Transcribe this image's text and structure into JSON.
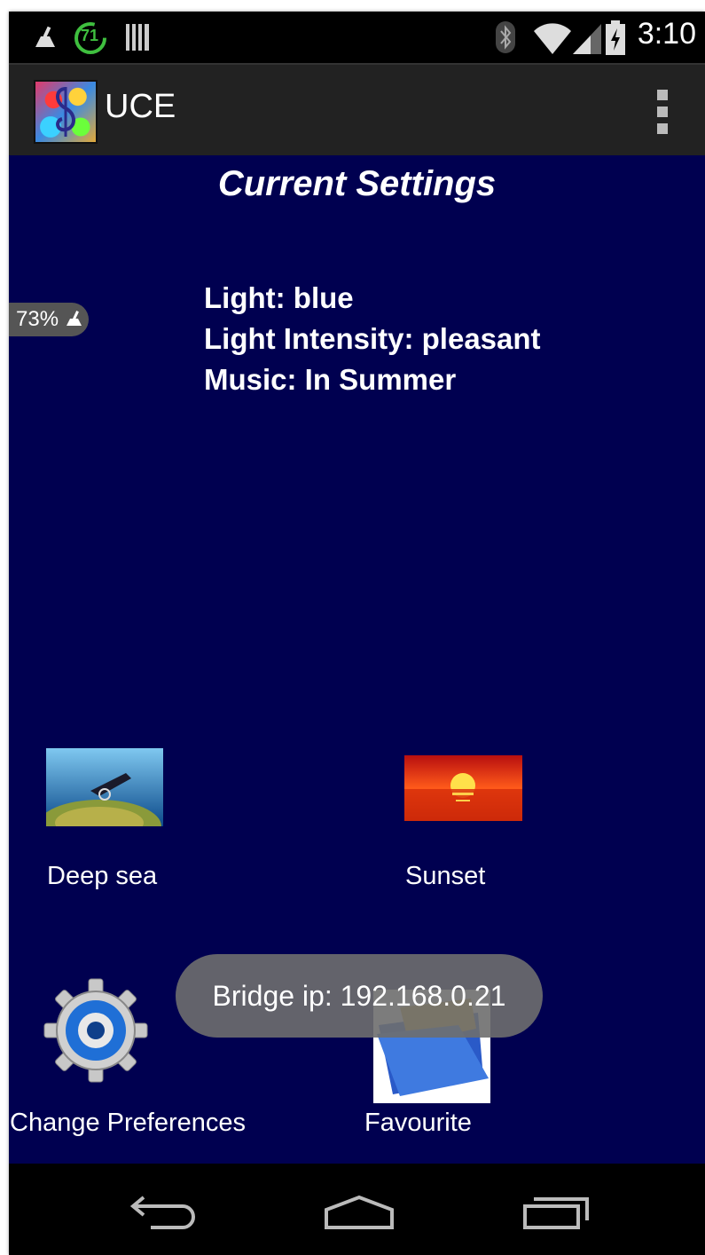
{
  "status_bar": {
    "time": "3:10",
    "notification_badge": "71",
    "icons": [
      "cleaner-icon",
      "timer-badge-icon",
      "barcode-icon",
      "bluetooth-icon",
      "wifi-icon",
      "signal-icon",
      "battery-charging-icon"
    ]
  },
  "action_bar": {
    "title": "UCE",
    "app_icon": "music-note-app-icon",
    "menu_icon": "overflow-menu-icon"
  },
  "main": {
    "heading": "Current Settings",
    "settings": [
      "Light: blue",
      "Light Intensity: pleasant",
      "Music: In Summer"
    ],
    "battery_badge": "73%",
    "tiles": [
      {
        "label": "Deep sea",
        "icon": "deep-sea-image"
      },
      {
        "label": "Sunset",
        "icon": "sunset-image"
      },
      {
        "label": "Change Preferences",
        "icon": "gear-icon"
      },
      {
        "label": "Favourite",
        "icon": "folder-icon"
      }
    ]
  },
  "toast": {
    "text": "Bridge ip: 192.168.0.21"
  },
  "nav_bar": {
    "icons": [
      "back-icon",
      "home-icon",
      "recent-apps-icon"
    ]
  },
  "colors": {
    "background": "#000050",
    "action_bar": "#222222",
    "toast": "#6e6e6e"
  }
}
